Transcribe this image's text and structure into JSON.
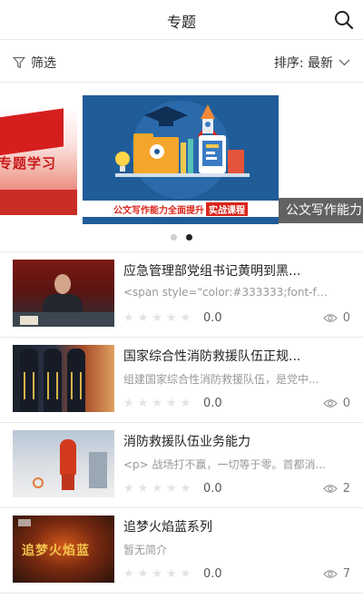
{
  "header": {
    "title": "专题",
    "search_icon": "search-icon"
  },
  "filterbar": {
    "filter_label": "筛选",
    "filter_icon": "funnel-icon",
    "sort_label": "排序: 最新",
    "sort_icon": "chevron-down-icon"
  },
  "carousel": {
    "left_slide_text": "专题学习",
    "main_slide_text": "公文写作能力全面提升",
    "main_slide_highlight": "实战课程",
    "right_caption": "公文写作能力",
    "dots": 2,
    "active_dot": 2
  },
  "list": [
    {
      "title": "应急管理部党组书记黄明到黑...",
      "summary": "<span style=\"color:#333333;font-fa...",
      "score": "0.0",
      "views": "0"
    },
    {
      "title": "国家综合性消防救援队伍正规...",
      "summary": "组建国家综合性消防救援队伍，是党中...",
      "score": "0.0",
      "views": "0"
    },
    {
      "title": "消防救援队伍业务能力",
      "summary": "<p> 战场打不赢，一切等于零。首都消...",
      "score": "0.0",
      "views": "2"
    },
    {
      "title": "追梦火焰蓝系列",
      "summary": "暂无简介",
      "score": "0.0",
      "views": "7",
      "thumb_text": "追梦火焰蓝"
    }
  ]
}
